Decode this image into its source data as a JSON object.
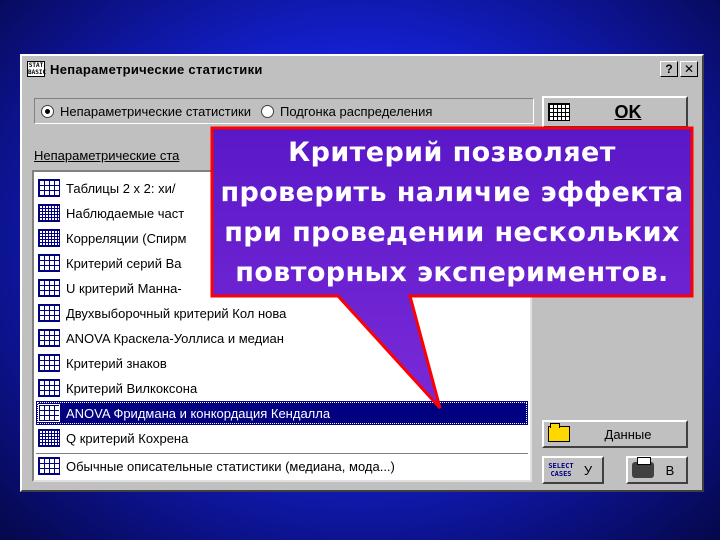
{
  "window": {
    "title": "Непараметрические статистики",
    "app_icon_text": "STAT BASIC",
    "help_button": "?",
    "close_button": "✕"
  },
  "mode": {
    "option1": "Непараметрические статистики",
    "option2": "Подгонка распределения",
    "selected": "option1"
  },
  "group_label": "Непараметрические ста",
  "list": {
    "items": [
      {
        "label": "Таблицы 2 х 2:  хи/"
      },
      {
        "label": "Наблюдаемые част"
      },
      {
        "label": "Корреляции (Спирм"
      },
      {
        "label": "Критерий серий Ва"
      },
      {
        "label": "U критерий Манна-"
      },
      {
        "label": "Двухвыборочный критерий Кол                      нова"
      },
      {
        "label": "ANOVA Краскела-Уоллиса и медиан"
      },
      {
        "label": "Критерий знаков"
      },
      {
        "label": "Критерий Вилкоксона"
      },
      {
        "label": "ANOVA Фридмана и конкордация Кендалла"
      },
      {
        "label": "Q критерий Кохрена"
      },
      {
        "label": "Обычные описательные статистики (медиана, мода...)"
      }
    ],
    "selected_index": 9
  },
  "buttons": {
    "ok": "OK",
    "data": "Данные",
    "select_cases": "SELECT CASES",
    "u": "У",
    "v": "В"
  },
  "callout": {
    "lines": [
      "Критерий позволяет",
      "проверить наличие эффекта",
      "при проведении нескольких",
      "повторных экспериментов."
    ],
    "fill_color": "#6a1fd0",
    "border_color": "#ff0000"
  }
}
